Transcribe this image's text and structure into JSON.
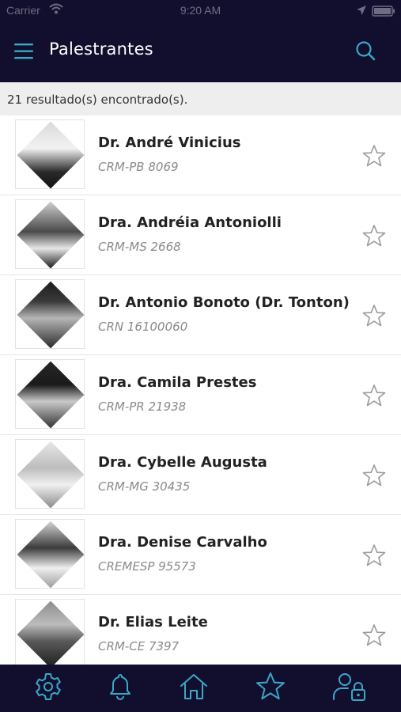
{
  "status_bar": {
    "carrier": "Carrier",
    "time": "9:20 AM"
  },
  "header": {
    "title": "Palestrantes",
    "menu_icon": "hamburger-menu-icon",
    "search_icon": "search-icon"
  },
  "results": {
    "count_text": "21 resultado(s) encontrado(s)."
  },
  "colors": {
    "nav_bg": "#120f2e",
    "accent": "#3aa8c8",
    "results_bg": "#eeeeee"
  },
  "speakers": [
    {
      "name": "Dr. André Vinicius",
      "registration": "CRM-PB 8069",
      "favorite": false
    },
    {
      "name": "Dra. Andréia Antoniolli",
      "registration": "CRM-MS 2668",
      "favorite": false
    },
    {
      "name": "Dr. Antonio Bonoto (Dr. Tonton)",
      "registration": "CRN 16100060",
      "favorite": false
    },
    {
      "name": "Dra. Camila Prestes",
      "registration": "CRM-PR 21938",
      "favorite": false
    },
    {
      "name": "Dra. Cybelle Augusta",
      "registration": "CRM-MG 30435",
      "favorite": false
    },
    {
      "name": "Dra. Denise Carvalho",
      "registration": "CREMESP 95573",
      "favorite": false
    },
    {
      "name": "Dr. Elias Leite",
      "registration": "CRM-CE 7397",
      "favorite": false
    }
  ],
  "tab_bar": {
    "tabs": [
      {
        "icon": "gear-icon"
      },
      {
        "icon": "bell-icon"
      },
      {
        "icon": "home-icon"
      },
      {
        "icon": "star-icon"
      },
      {
        "icon": "user-lock-icon"
      }
    ]
  }
}
